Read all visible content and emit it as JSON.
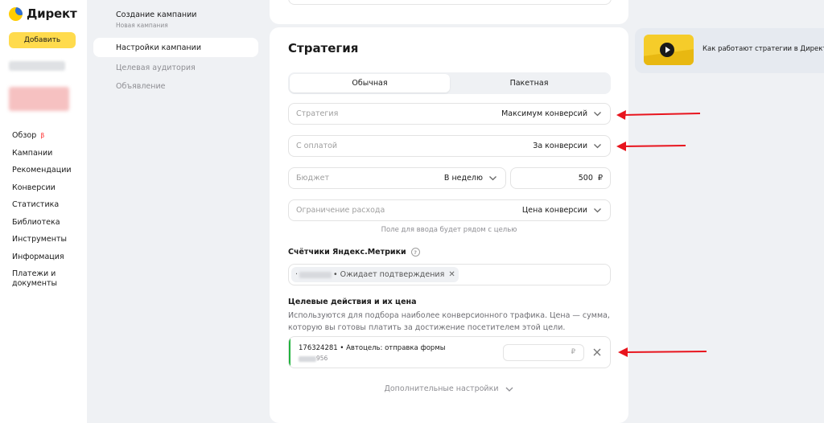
{
  "app": {
    "logo_text": "Директ",
    "add_button": "Добавить"
  },
  "sidebar": {
    "items": [
      {
        "label": "Обзор",
        "badge": "β"
      },
      {
        "label": "Кампании"
      },
      {
        "label": "Рекомендации"
      },
      {
        "label": "Конверсии"
      },
      {
        "label": "Статистика"
      },
      {
        "label": "Библиотека"
      },
      {
        "label": "Инструменты"
      },
      {
        "label": "Информация"
      },
      {
        "label": "Платежи и документы"
      }
    ]
  },
  "stepper": {
    "title": "Создание кампании",
    "subtitle": "Новая кампания",
    "steps": [
      {
        "label": "Настройки кампании",
        "active": true
      },
      {
        "label": "Целевая аудитория",
        "active": false
      },
      {
        "label": "Объявление",
        "active": false
      }
    ]
  },
  "strategy": {
    "title": "Стратегия",
    "tabs": [
      {
        "label": "Обычная",
        "active": true
      },
      {
        "label": "Пакетная",
        "active": false
      }
    ],
    "strategy_field": {
      "placeholder": "Стратегия",
      "value": "Максимум конверсий"
    },
    "payment_field": {
      "placeholder": "С оплатой",
      "value": "За конверсии"
    },
    "budget_field": {
      "placeholder": "Бюджет",
      "value": "В неделю"
    },
    "budget_amount": {
      "value": "500",
      "currency": "₽"
    },
    "limit_field": {
      "placeholder": "Ограничение расхода",
      "value": "Цена конверсии"
    },
    "limit_hint": "Поле для ввода будет рядом с целью"
  },
  "counters": {
    "title": "Счётчики Яндекс.Метрики",
    "chip_prefix": "·",
    "chip_status": "• Ожидает подтверждения"
  },
  "goals": {
    "title": "Целевые действия и их цена",
    "description": "Используются для подбора наиболее конверсионного трафика. Цена — сумма, которую вы готовы платить за достижение посетителем этой цели.",
    "items": [
      {
        "name": "176324281 • Автоцель: отправка формы",
        "id_tail": "956",
        "price_currency": "₽"
      }
    ]
  },
  "more_settings": "Дополнительные настройки",
  "promo": {
    "text": "Как работают стратегии в Директе?"
  },
  "colors": {
    "accent_yellow": "#ffdb4d",
    "annotation_red": "#e8141d",
    "goal_green": "#22b33e",
    "background": "#eff1f4"
  }
}
